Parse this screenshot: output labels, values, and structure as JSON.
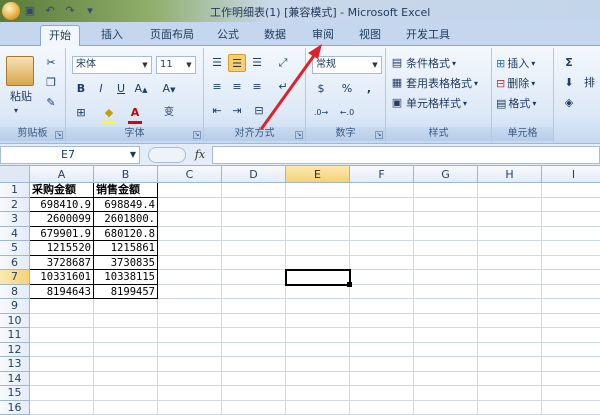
{
  "title_bar": {
    "title": "工作明细表(1)  [兼容模式] - Microsoft Excel",
    "quick_access": [
      "save-icon",
      "undo-icon",
      "redo-icon",
      "customize-icon"
    ]
  },
  "tabs": [
    {
      "label": "开始",
      "active": true
    },
    {
      "label": "插入"
    },
    {
      "label": "页面布局"
    },
    {
      "label": "公式"
    },
    {
      "label": "数据"
    },
    {
      "label": "审阅"
    },
    {
      "label": "视图"
    },
    {
      "label": "开发工具"
    }
  ],
  "ribbon": {
    "clipboard": {
      "group_label": "剪贴板",
      "paste_label": "粘贴"
    },
    "font": {
      "group_label": "字体",
      "font_name": "宋体",
      "font_size": "11",
      "bold": "B",
      "italic": "I",
      "underline": "U",
      "font_color_a": "A",
      "wen": "变"
    },
    "alignment": {
      "group_label": "对齐方式"
    },
    "number": {
      "group_label": "数字",
      "format": "常规",
      "percent": "%",
      "comma": ","
    },
    "styles": {
      "group_label": "样式",
      "conditional": "条件格式",
      "table_format": "套用表格格式",
      "cell_styles": "单元格样式"
    },
    "cells": {
      "group_label": "单元格",
      "insert": "插入",
      "delete": "删除",
      "format": "格式"
    },
    "editing": {
      "sigma": "Σ",
      "partial_label": "排"
    }
  },
  "formula_bar": {
    "name_box": "E7",
    "fx": "fx",
    "formula": ""
  },
  "sheet": {
    "columns": [
      "A",
      "B",
      "C",
      "D",
      "E",
      "F",
      "G",
      "H",
      "I"
    ],
    "active_column": "E",
    "rows": [
      "1",
      "2",
      "3",
      "4",
      "5",
      "6",
      "7",
      "8",
      "9",
      "10",
      "11",
      "12",
      "13",
      "14",
      "15",
      "16"
    ],
    "active_row": "7",
    "selected_cell": "E7",
    "headers": [
      "采购金额",
      "销售金额"
    ],
    "data": [
      [
        "698410.9",
        "698849.4"
      ],
      [
        "2600099",
        "2601800."
      ],
      [
        "679901.9",
        "680120.8"
      ],
      [
        "1215520",
        "1215861"
      ],
      [
        "3728687",
        "3730835"
      ],
      [
        "10331601",
        "10338115"
      ],
      [
        "8194643",
        "8199457"
      ]
    ]
  },
  "colors": {
    "accent_selection": "#f9cf6b",
    "annotation_arrow": "#e0202a"
  }
}
